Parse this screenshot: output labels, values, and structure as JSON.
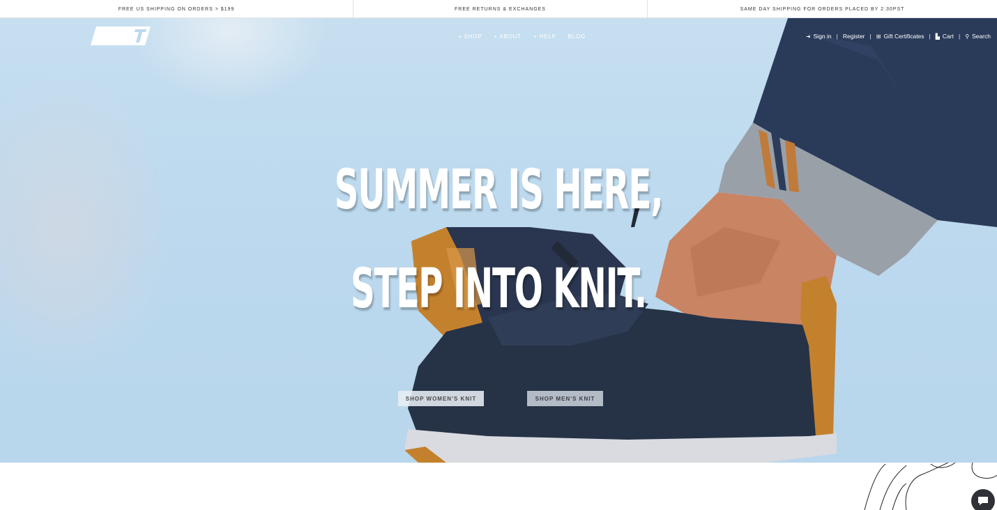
{
  "announcements": [
    "FREE US SHIPPING ON ORDERS > $199",
    "FREE RETURNS & EXCHANGES",
    "SAME DAY SHIPPING FOR ORDERS PLACED BY 2:30PST"
  ],
  "nav": {
    "shop": "+ SHOP",
    "about": "+ ABOUT",
    "help": "+ HELP",
    "blog": "BLOG"
  },
  "util": {
    "sign_in": "Sign in",
    "register": "Register",
    "gift": "Gift Certificates",
    "cart": "Cart",
    "search": "Search",
    "sep": "|"
  },
  "hero": {
    "line1": "SUMMER IS HERE,",
    "line2": "STEP INTO KNIT.",
    "cta_women": "SHOP WOMEN'S KNIT",
    "cta_men": "SHOP MEN'S KNIT"
  },
  "colors": {
    "sky": "#bcd9ee",
    "denim": "#2a3b5a",
    "shoe": "#263246",
    "sole_accent": "#c4812d",
    "chat": "#2f3136"
  },
  "icons": {
    "sign_in": "sign-in-icon",
    "gift": "gift-icon",
    "cart": "cart-icon",
    "search": "search-icon",
    "chat": "chat-icon"
  }
}
